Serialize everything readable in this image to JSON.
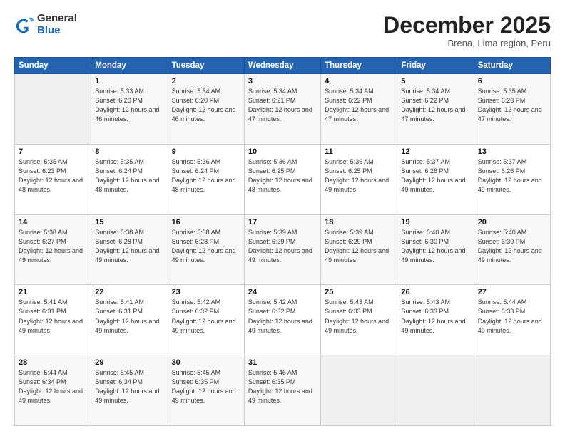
{
  "logo": {
    "general": "General",
    "blue": "Blue"
  },
  "header": {
    "month": "December 2025",
    "location": "Brena, Lima region, Peru"
  },
  "weekdays": [
    "Sunday",
    "Monday",
    "Tuesday",
    "Wednesday",
    "Thursday",
    "Friday",
    "Saturday"
  ],
  "weeks": [
    [
      {
        "day": "",
        "empty": true
      },
      {
        "day": "1",
        "sunrise": "Sunrise: 5:33 AM",
        "sunset": "Sunset: 6:20 PM",
        "daylight": "Daylight: 12 hours and 46 minutes."
      },
      {
        "day": "2",
        "sunrise": "Sunrise: 5:34 AM",
        "sunset": "Sunset: 6:20 PM",
        "daylight": "Daylight: 12 hours and 46 minutes."
      },
      {
        "day": "3",
        "sunrise": "Sunrise: 5:34 AM",
        "sunset": "Sunset: 6:21 PM",
        "daylight": "Daylight: 12 hours and 47 minutes."
      },
      {
        "day": "4",
        "sunrise": "Sunrise: 5:34 AM",
        "sunset": "Sunset: 6:22 PM",
        "daylight": "Daylight: 12 hours and 47 minutes."
      },
      {
        "day": "5",
        "sunrise": "Sunrise: 5:34 AM",
        "sunset": "Sunset: 6:22 PM",
        "daylight": "Daylight: 12 hours and 47 minutes."
      },
      {
        "day": "6",
        "sunrise": "Sunrise: 5:35 AM",
        "sunset": "Sunset: 6:23 PM",
        "daylight": "Daylight: 12 hours and 47 minutes."
      }
    ],
    [
      {
        "day": "7",
        "sunrise": "Sunrise: 5:35 AM",
        "sunset": "Sunset: 6:23 PM",
        "daylight": "Daylight: 12 hours and 48 minutes."
      },
      {
        "day": "8",
        "sunrise": "Sunrise: 5:35 AM",
        "sunset": "Sunset: 6:24 PM",
        "daylight": "Daylight: 12 hours and 48 minutes."
      },
      {
        "day": "9",
        "sunrise": "Sunrise: 5:36 AM",
        "sunset": "Sunset: 6:24 PM",
        "daylight": "Daylight: 12 hours and 48 minutes."
      },
      {
        "day": "10",
        "sunrise": "Sunrise: 5:36 AM",
        "sunset": "Sunset: 6:25 PM",
        "daylight": "Daylight: 12 hours and 48 minutes."
      },
      {
        "day": "11",
        "sunrise": "Sunrise: 5:36 AM",
        "sunset": "Sunset: 6:25 PM",
        "daylight": "Daylight: 12 hours and 49 minutes."
      },
      {
        "day": "12",
        "sunrise": "Sunrise: 5:37 AM",
        "sunset": "Sunset: 6:26 PM",
        "daylight": "Daylight: 12 hours and 49 minutes."
      },
      {
        "day": "13",
        "sunrise": "Sunrise: 5:37 AM",
        "sunset": "Sunset: 6:26 PM",
        "daylight": "Daylight: 12 hours and 49 minutes."
      }
    ],
    [
      {
        "day": "14",
        "sunrise": "Sunrise: 5:38 AM",
        "sunset": "Sunset: 6:27 PM",
        "daylight": "Daylight: 12 hours and 49 minutes."
      },
      {
        "day": "15",
        "sunrise": "Sunrise: 5:38 AM",
        "sunset": "Sunset: 6:28 PM",
        "daylight": "Daylight: 12 hours and 49 minutes."
      },
      {
        "day": "16",
        "sunrise": "Sunrise: 5:38 AM",
        "sunset": "Sunset: 6:28 PM",
        "daylight": "Daylight: 12 hours and 49 minutes."
      },
      {
        "day": "17",
        "sunrise": "Sunrise: 5:39 AM",
        "sunset": "Sunset: 6:29 PM",
        "daylight": "Daylight: 12 hours and 49 minutes."
      },
      {
        "day": "18",
        "sunrise": "Sunrise: 5:39 AM",
        "sunset": "Sunset: 6:29 PM",
        "daylight": "Daylight: 12 hours and 49 minutes."
      },
      {
        "day": "19",
        "sunrise": "Sunrise: 5:40 AM",
        "sunset": "Sunset: 6:30 PM",
        "daylight": "Daylight: 12 hours and 49 minutes."
      },
      {
        "day": "20",
        "sunrise": "Sunrise: 5:40 AM",
        "sunset": "Sunset: 6:30 PM",
        "daylight": "Daylight: 12 hours and 49 minutes."
      }
    ],
    [
      {
        "day": "21",
        "sunrise": "Sunrise: 5:41 AM",
        "sunset": "Sunset: 6:31 PM",
        "daylight": "Daylight: 12 hours and 49 minutes."
      },
      {
        "day": "22",
        "sunrise": "Sunrise: 5:41 AM",
        "sunset": "Sunset: 6:31 PM",
        "daylight": "Daylight: 12 hours and 49 minutes."
      },
      {
        "day": "23",
        "sunrise": "Sunrise: 5:42 AM",
        "sunset": "Sunset: 6:32 PM",
        "daylight": "Daylight: 12 hours and 49 minutes."
      },
      {
        "day": "24",
        "sunrise": "Sunrise: 5:42 AM",
        "sunset": "Sunset: 6:32 PM",
        "daylight": "Daylight: 12 hours and 49 minutes."
      },
      {
        "day": "25",
        "sunrise": "Sunrise: 5:43 AM",
        "sunset": "Sunset: 6:33 PM",
        "daylight": "Daylight: 12 hours and 49 minutes."
      },
      {
        "day": "26",
        "sunrise": "Sunrise: 5:43 AM",
        "sunset": "Sunset: 6:33 PM",
        "daylight": "Daylight: 12 hours and 49 minutes."
      },
      {
        "day": "27",
        "sunrise": "Sunrise: 5:44 AM",
        "sunset": "Sunset: 6:33 PM",
        "daylight": "Daylight: 12 hours and 49 minutes."
      }
    ],
    [
      {
        "day": "28",
        "sunrise": "Sunrise: 5:44 AM",
        "sunset": "Sunset: 6:34 PM",
        "daylight": "Daylight: 12 hours and 49 minutes."
      },
      {
        "day": "29",
        "sunrise": "Sunrise: 5:45 AM",
        "sunset": "Sunset: 6:34 PM",
        "daylight": "Daylight: 12 hours and 49 minutes."
      },
      {
        "day": "30",
        "sunrise": "Sunrise: 5:45 AM",
        "sunset": "Sunset: 6:35 PM",
        "daylight": "Daylight: 12 hours and 49 minutes."
      },
      {
        "day": "31",
        "sunrise": "Sunrise: 5:46 AM",
        "sunset": "Sunset: 6:35 PM",
        "daylight": "Daylight: 12 hours and 49 minutes."
      },
      {
        "day": "",
        "empty": true
      },
      {
        "day": "",
        "empty": true
      },
      {
        "day": "",
        "empty": true
      }
    ]
  ]
}
